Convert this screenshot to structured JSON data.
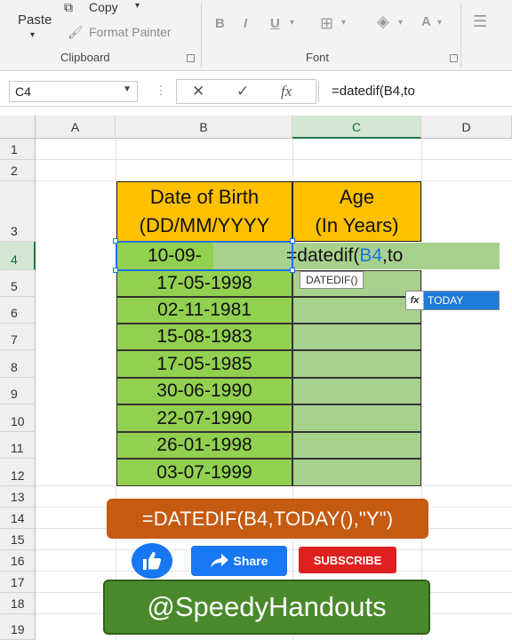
{
  "ribbon": {
    "paste_label": "Paste",
    "copy_label": "Copy",
    "format_painter_label": "Format Painter",
    "clipboard_group": "Clipboard",
    "font_group": "Font",
    "bold": "B",
    "italic": "I",
    "underline": "U",
    "font_color_letter": "A"
  },
  "formula_bar": {
    "name_box": "C4",
    "cancel": "✕",
    "enter": "✓",
    "fx": "fx",
    "formula": "=datedif(B4,to"
  },
  "columns": [
    "A",
    "B",
    "C",
    "D"
  ],
  "rows": [
    "1",
    "2",
    "3",
    "4",
    "5",
    "6",
    "7",
    "8",
    "9",
    "10",
    "11",
    "12",
    "13",
    "14",
    "15",
    "16",
    "17",
    "18",
    "19"
  ],
  "table": {
    "header_dob_line1": "Date of Birth",
    "header_dob_line2": "(DD/MM/YYYY",
    "header_age_line1": "Age",
    "header_age_line2": "(In Years)",
    "dob_values": [
      "10-09-",
      "17-05-1998",
      "02-11-1981",
      "15-08-1983",
      "17-05-1985",
      "30-06-1990",
      "22-07-1990",
      "26-01-1998",
      "03-07-1999"
    ],
    "editing_formula_prefix": "=datedif(",
    "editing_formula_ref": "B4",
    "editing_formula_suffix": ",to"
  },
  "tooltip": "DATEDIF()",
  "autocomplete": {
    "item": "TODAY"
  },
  "overlay": {
    "formula_banner": "=DATEDIF(B4,TODAY(),\"Y\")",
    "share_label": "Share",
    "subscribe_label": "SUBSCRIBE",
    "handle": "@SpeedyHandouts"
  },
  "colors": {
    "header_fill": "#ffc000",
    "dob_fill": "#92d050",
    "age_fill": "#a9d18e",
    "excel_green": "#217346",
    "banner_orange": "#c55a11",
    "handle_green": "#4a8a2c"
  }
}
